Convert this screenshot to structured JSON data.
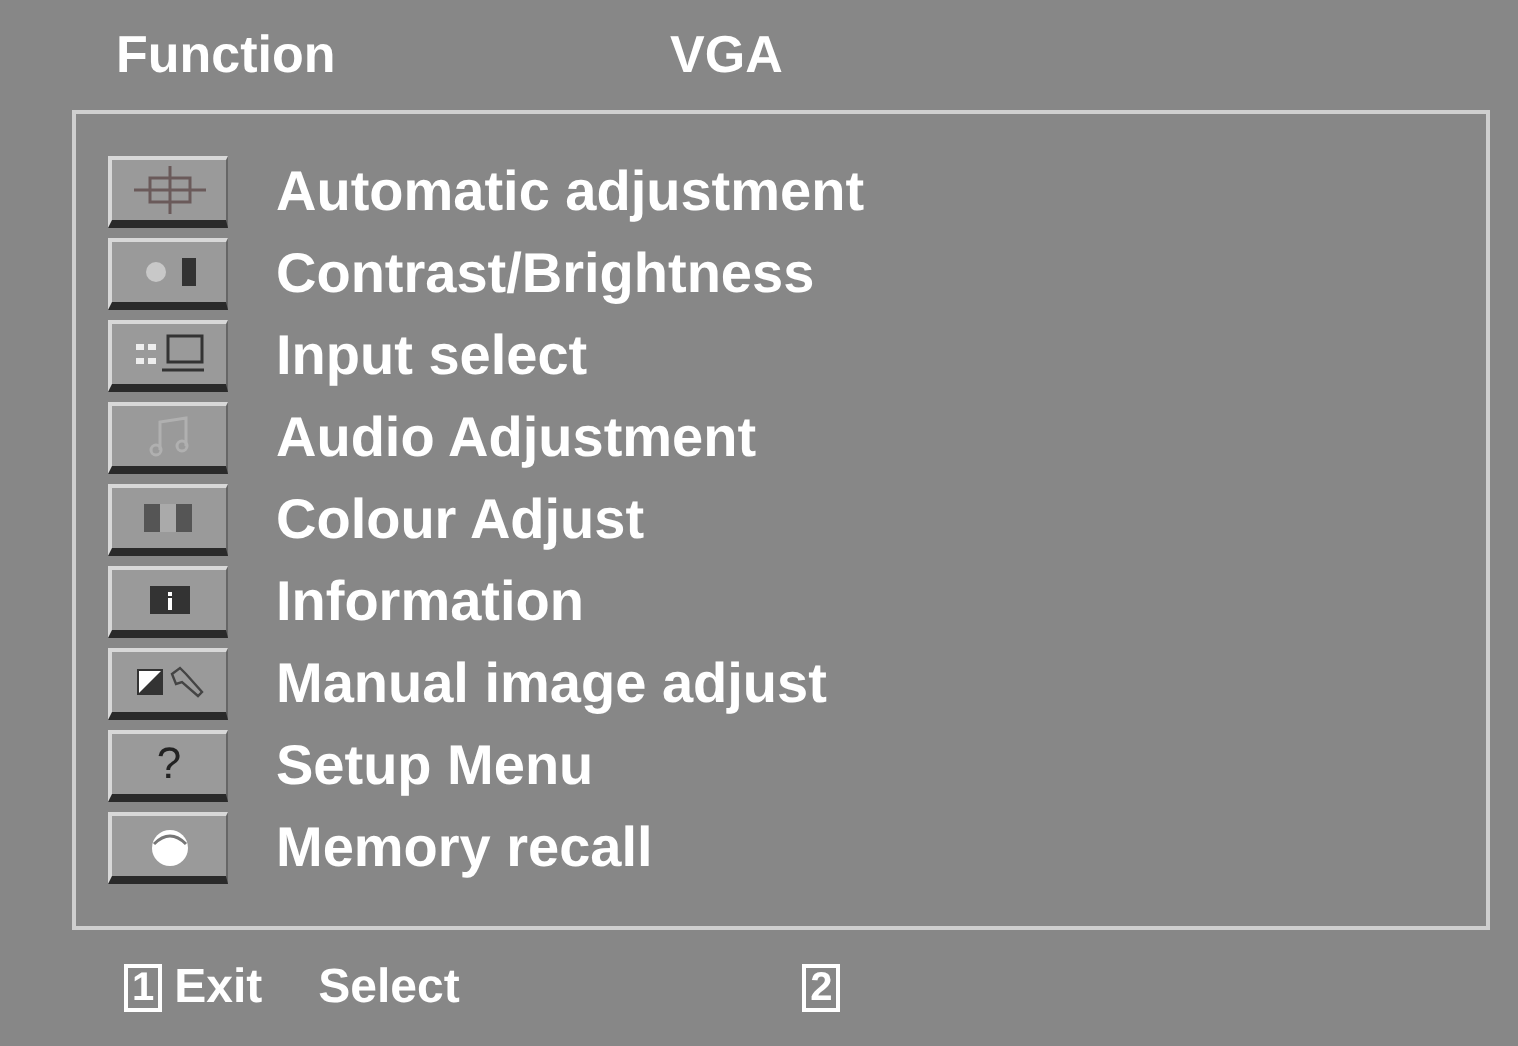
{
  "header": {
    "title": "Function",
    "source": "VGA"
  },
  "menu": [
    {
      "kind": "position",
      "label": "Automatic adjustment"
    },
    {
      "kind": "contrast",
      "label": "Contrast/Brightness"
    },
    {
      "kind": "input",
      "label": "Input select"
    },
    {
      "kind": "audio",
      "label": "Audio Adjustment"
    },
    {
      "kind": "colour",
      "label": "Colour Adjust"
    },
    {
      "kind": "info",
      "label": "Information"
    },
    {
      "kind": "manual",
      "label": "Manual image adjust"
    },
    {
      "kind": "setup",
      "label": "Setup Menu",
      "icon_char": "?"
    },
    {
      "kind": "memory",
      "label": "Memory recall"
    }
  ],
  "footer": {
    "key1": "1",
    "exit": "Exit",
    "select": "Select",
    "key2": "2"
  }
}
